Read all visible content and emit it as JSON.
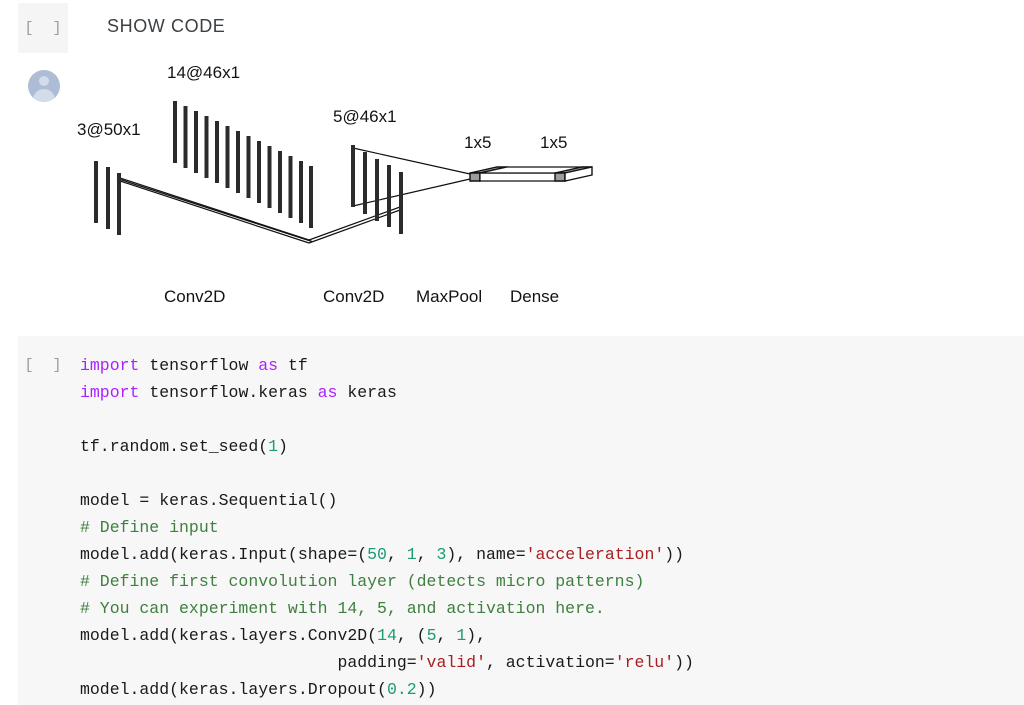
{
  "top_cell": {
    "run_marker": "[ ]",
    "show_code_label": "SHOW CODE",
    "avatar_icon": "user-avatar-icon"
  },
  "diagram": {
    "title": "CNN architecture diagram",
    "layers": [
      {
        "id": "input",
        "shape_label": "3@50x1",
        "name_label": "",
        "bars": 3
      },
      {
        "id": "conv2d_1",
        "shape_label": "14@46x1",
        "name_label": "Conv2D",
        "bars": 14
      },
      {
        "id": "conv2d_2",
        "shape_label": "5@46x1",
        "name_label": "Conv2D",
        "bars": 5
      },
      {
        "id": "maxpool",
        "shape_label": "1x5",
        "name_label": "MaxPool",
        "bars": 1
      },
      {
        "id": "dense",
        "shape_label": "1x5",
        "name_label": "Dense",
        "bars": 1
      }
    ],
    "shape_labels": {
      "input": "3@50x1",
      "conv1": "14@46x1",
      "conv2": "5@46x1",
      "maxpool": "1x5",
      "dense": "1x5"
    },
    "name_labels": {
      "conv1": "Conv2D",
      "conv2": "Conv2D",
      "maxpool": "MaxPool",
      "dense": "Dense"
    },
    "colors": {
      "bar": "#2b2b2b",
      "outline": "#111111",
      "block_fill": "#9d9d9d"
    }
  },
  "code_cell": {
    "run_marker": "[ ]",
    "background": "#f7f7f7",
    "syntax_colors": {
      "keyword": "#aa22ff",
      "number": "#1a9c74",
      "string": "#a81e21",
      "comment": "#3f7f3f",
      "text": "#1a1a1a"
    },
    "lines": [
      {
        "tokens": [
          {
            "t": "import",
            "c": "kw"
          },
          {
            "t": " tensorflow ",
            "c": ""
          },
          {
            "t": "as",
            "c": "kw"
          },
          {
            "t": " tf",
            "c": ""
          }
        ]
      },
      {
        "tokens": [
          {
            "t": "import",
            "c": "kw"
          },
          {
            "t": " tensorflow.keras ",
            "c": ""
          },
          {
            "t": "as",
            "c": "kw"
          },
          {
            "t": " keras",
            "c": ""
          }
        ]
      },
      {
        "tokens": []
      },
      {
        "tokens": [
          {
            "t": "tf.random.set_seed(",
            "c": ""
          },
          {
            "t": "1",
            "c": "num"
          },
          {
            "t": ")",
            "c": ""
          }
        ]
      },
      {
        "tokens": []
      },
      {
        "tokens": [
          {
            "t": "model = keras.Sequential()",
            "c": ""
          }
        ]
      },
      {
        "tokens": [
          {
            "t": "# Define input",
            "c": "cmt"
          }
        ]
      },
      {
        "tokens": [
          {
            "t": "model.add(keras.Input(shape=(",
            "c": ""
          },
          {
            "t": "50",
            "c": "num"
          },
          {
            "t": ", ",
            "c": ""
          },
          {
            "t": "1",
            "c": "num"
          },
          {
            "t": ", ",
            "c": ""
          },
          {
            "t": "3",
            "c": "num"
          },
          {
            "t": "), name=",
            "c": ""
          },
          {
            "t": "'acceleration'",
            "c": "str"
          },
          {
            "t": "))",
            "c": ""
          }
        ]
      },
      {
        "tokens": [
          {
            "t": "# Define first convolution layer (detects micro patterns)",
            "c": "cmt"
          }
        ]
      },
      {
        "tokens": [
          {
            "t": "# You can experiment with 14, 5, and activation here.",
            "c": "cmt"
          }
        ]
      },
      {
        "tokens": [
          {
            "t": "model.add(keras.layers.Conv2D(",
            "c": ""
          },
          {
            "t": "14",
            "c": "num"
          },
          {
            "t": ", (",
            "c": ""
          },
          {
            "t": "5",
            "c": "num"
          },
          {
            "t": ", ",
            "c": ""
          },
          {
            "t": "1",
            "c": "num"
          },
          {
            "t": "),",
            "c": ""
          }
        ]
      },
      {
        "tokens": [
          {
            "t": "                          padding=",
            "c": ""
          },
          {
            "t": "'valid'",
            "c": "str"
          },
          {
            "t": ", activation=",
            "c": ""
          },
          {
            "t": "'relu'",
            "c": "str"
          },
          {
            "t": "))",
            "c": ""
          }
        ]
      },
      {
        "tokens": [
          {
            "t": "model.add(keras.layers.Dropout(",
            "c": ""
          },
          {
            "t": "0.2",
            "c": "num"
          },
          {
            "t": "))",
            "c": ""
          }
        ]
      }
    ]
  }
}
